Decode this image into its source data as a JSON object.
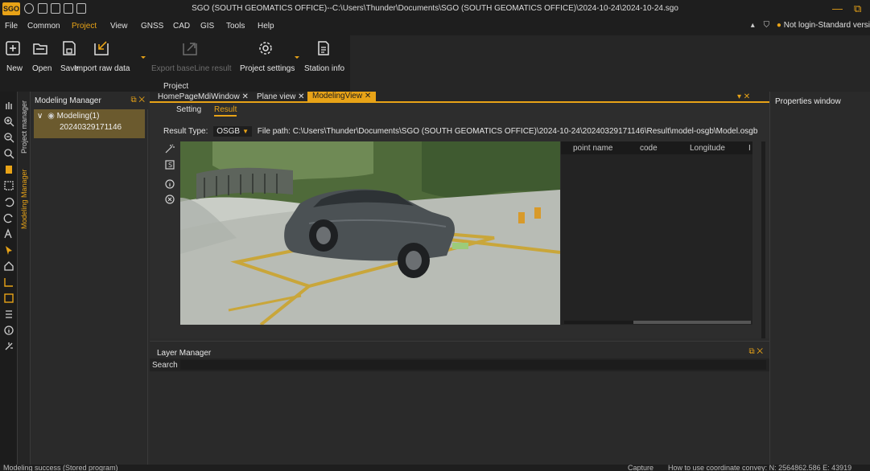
{
  "app": {
    "logo": "SGO",
    "title": "SGO (SOUTH GEOMATICS OFFICE)--C:\\Users\\Thunder\\Documents\\SGO (SOUTH GEOMATICS OFFICE)\\2024-10-24\\2024-10-24.sgo",
    "minimize_glyph": "—",
    "restore_glyph": "⧉"
  },
  "menu": {
    "items": [
      "File",
      "Common",
      "Project",
      "View",
      "GNSS",
      "CAD",
      "GIS",
      "Tools",
      "Help"
    ],
    "active": "Project",
    "login_status": "Not login-Standard versi"
  },
  "ribbon": {
    "buttons": [
      {
        "label": "New",
        "icon": "new-icon"
      },
      {
        "label": "Open",
        "icon": "open-folder-icon"
      },
      {
        "label": "Save",
        "icon": "save-icon"
      },
      {
        "label": "Import raw data",
        "icon": "import-icon"
      },
      {
        "label": "Export baseLine result",
        "icon": "export-icon",
        "disabled": true
      },
      {
        "label": "Project settings",
        "icon": "gear-icon"
      },
      {
        "label": "Station info",
        "icon": "document-icon"
      }
    ],
    "group_label": "Project"
  },
  "side_tabs": {
    "project_manager": "Project manager",
    "modeling_manager": "Modeling Manager"
  },
  "modeling_manager": {
    "title": "Modeling Manager",
    "close_glyph": "⧉ ✕",
    "tree_root": "Modeling(1)",
    "tree_child": "20240329171146"
  },
  "doc_tabs": {
    "tabs": [
      {
        "label": "HomePageMdiWindow ✕"
      },
      {
        "label": "Plane view ✕"
      },
      {
        "label": "ModelingView ✕",
        "active": true
      }
    ],
    "pin_glyph": "▾ ✕"
  },
  "modeling_view": {
    "subtabs": [
      "Setting",
      "Result"
    ],
    "active_subtab": "Result",
    "result_type_label": "Result Type:",
    "result_type_value": "OSGB",
    "file_path_label": "File path:",
    "file_path": "C:\\Users\\Thunder\\Documents\\SGO (SOUTH GEOMATICS OFFICE)\\2024-10-24\\20240329171146\\Result\\model-osgb\\Model.osgb",
    "table_columns": [
      "point name",
      "code",
      "Longitude",
      "I"
    ]
  },
  "layer_manager": {
    "title": "Layer Manager",
    "search_label": "Search"
  },
  "properties": {
    "title": "Properties window"
  },
  "status": {
    "left": "Modeling success (Stored program)",
    "right_label": "Capture",
    "coords": "How to use coordinate convey: N: 2564862.586   E: 43919"
  },
  "colors": {
    "accent": "#e8a317",
    "background": "#2b2b2b",
    "panel": "#2a2a2a",
    "titlebar": "#1e1e1e"
  }
}
